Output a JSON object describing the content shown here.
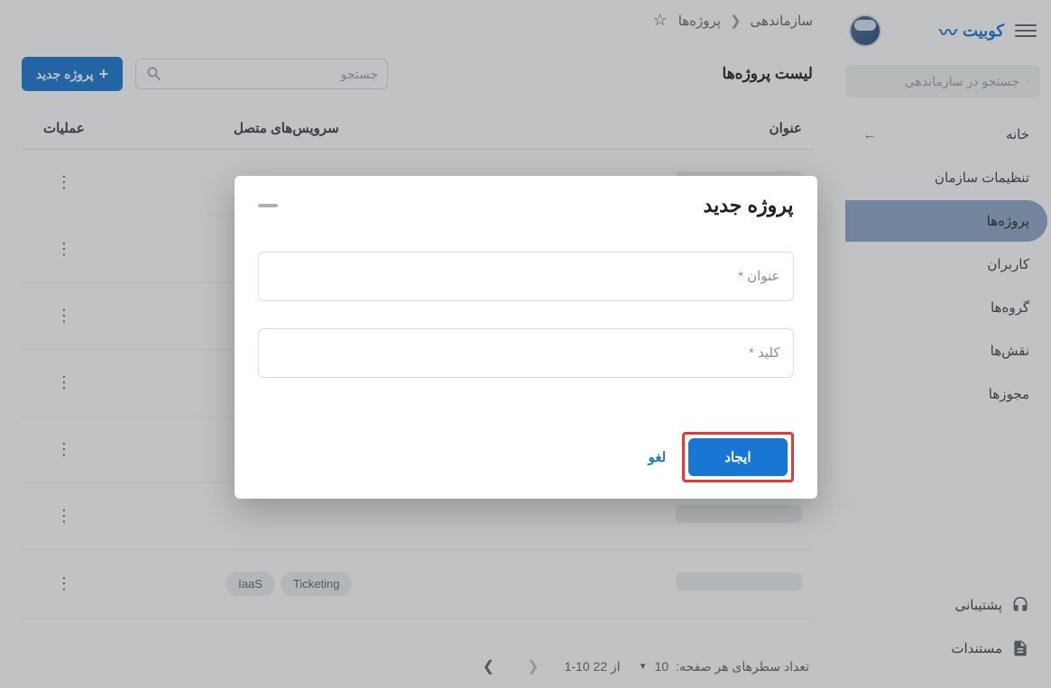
{
  "brand": "کوبیت",
  "sidebar": {
    "search_placeholder": "جستجو در سازماندهی",
    "items": [
      {
        "label": "خانه",
        "has_arrow": true,
        "active": false
      },
      {
        "label": "تنظیمات سازمان",
        "has_arrow": false,
        "active": false
      },
      {
        "label": "پروژه‌ها",
        "has_arrow": false,
        "active": true
      },
      {
        "label": "کاربران",
        "has_arrow": false,
        "active": false
      },
      {
        "label": "گروه‌ها",
        "has_arrow": false,
        "active": false
      },
      {
        "label": "نقش‌ها",
        "has_arrow": false,
        "active": false
      },
      {
        "label": "مجوزها",
        "has_arrow": false,
        "active": false
      }
    ],
    "footer": {
      "support": "پشتیبانی",
      "docs": "مستندات"
    }
  },
  "breadcrumb": {
    "org": "سازماندهی",
    "projects": "پروژه‌ها"
  },
  "toolbar": {
    "title": "لیست پروژه‌ها",
    "search_placeholder": "جستجو",
    "new_project": "پروژه جدید"
  },
  "table": {
    "headers": {
      "title": "عنوان",
      "services": "سرویس‌های متصل",
      "actions": "عملیات"
    },
    "rows": [
      {
        "services": []
      },
      {
        "services": []
      },
      {
        "services": []
      },
      {
        "services": []
      },
      {
        "services": []
      },
      {
        "services": []
      },
      {
        "services": [
          "Ticketing",
          "IaaS"
        ]
      }
    ]
  },
  "pagination": {
    "rows_per_page_label": "تعداد سطرهای هر صفحه:",
    "rows_per_page_value": "10",
    "range": "1-10 از 22"
  },
  "modal": {
    "title": "پروژه جدید",
    "title_field_label": "عنوان *",
    "key_field_label": "کلید *",
    "create": "ایجاد",
    "cancel": "لغو"
  }
}
